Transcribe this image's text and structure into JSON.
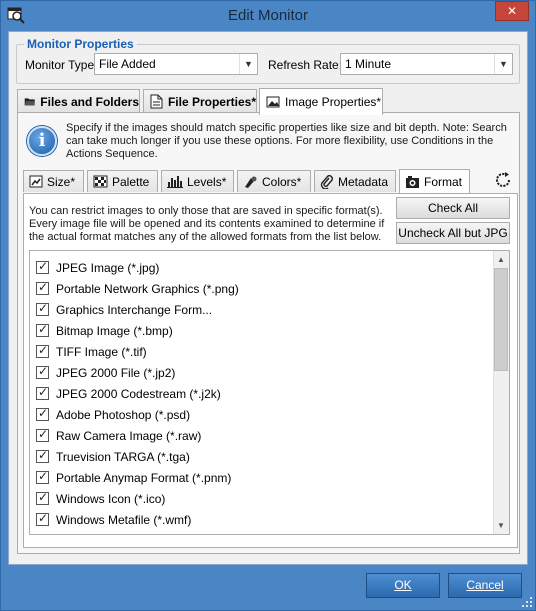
{
  "window": {
    "title": "Edit Monitor",
    "close_label": "✕"
  },
  "monitor_properties": {
    "group_title": "Monitor Properties",
    "type_label": "Monitor Type:",
    "type_value": "File Added",
    "rate_label": "Refresh Rate:",
    "rate_value": "1 Minute"
  },
  "tabs": [
    {
      "label": "Files and Folders",
      "icon": "folder-icon",
      "active": false
    },
    {
      "label": "File Properties*",
      "icon": "file-properties-icon",
      "active": false
    },
    {
      "label": "Image Properties*",
      "icon": "image-properties-icon",
      "active": true
    }
  ],
  "info": {
    "icon_glyph": "i",
    "text": "Specify if the images should match specific properties like size and bit depth. Note: Search can take much longer if you use these options. For more flexibility, use Conditions in the Actions Sequence."
  },
  "subtabs": [
    {
      "label": "Size*",
      "icon": "size-icon",
      "active": false
    },
    {
      "label": "Palette",
      "icon": "palette-icon",
      "active": false
    },
    {
      "label": "Levels*",
      "icon": "levels-icon",
      "active": false
    },
    {
      "label": "Colors*",
      "icon": "colors-icon",
      "active": false
    },
    {
      "label": "Metadata",
      "icon": "paperclip-icon",
      "active": false
    },
    {
      "label": "Format",
      "icon": "format-icon",
      "active": true
    }
  ],
  "format": {
    "description": "You can restrict images to only those that are saved in specific format(s). Every image file will be opened and its contents examined to determine if the actual format matches any of the allowed formats from the list below.",
    "check_all_label": "Check All",
    "uncheck_all_label": "Uncheck All but JPG",
    "formats": [
      {
        "label": "JPEG Image (*.jpg)",
        "checked": true
      },
      {
        "label": "Portable Network Graphics (*.png)",
        "checked": true
      },
      {
        "label": "Graphics Interchange Form...",
        "checked": true
      },
      {
        "label": "Bitmap Image (*.bmp)",
        "checked": true
      },
      {
        "label": "TIFF Image (*.tif)",
        "checked": true
      },
      {
        "label": "JPEG 2000 File (*.jp2)",
        "checked": true
      },
      {
        "label": "JPEG 2000 Codestream (*.j2k)",
        "checked": true
      },
      {
        "label": "Adobe Photoshop (*.psd)",
        "checked": true
      },
      {
        "label": "Raw Camera Image (*.raw)",
        "checked": true
      },
      {
        "label": "Truevision TARGA (*.tga)",
        "checked": true
      },
      {
        "label": "Portable Anymap Format (*.pnm)",
        "checked": true
      },
      {
        "label": "Windows Icon (*.ico)",
        "checked": true
      },
      {
        "label": "Windows Metafile (*.wmf)",
        "checked": true
      }
    ]
  },
  "footer": {
    "ok_label": "OK",
    "cancel_label": "Cancel"
  },
  "colors": {
    "accent": "#1a5fb4",
    "window_frame": "#4a86c6",
    "close_red": "#c7463c"
  }
}
